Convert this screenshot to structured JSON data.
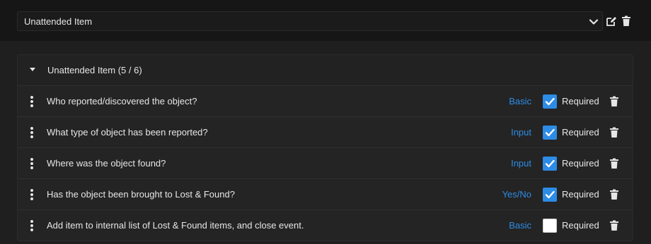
{
  "selector": {
    "value": "Unattended Item"
  },
  "panel": {
    "title": "Unattended Item (5 / 6)"
  },
  "items": [
    {
      "question": "Who reported/discovered the object?",
      "type": "Basic",
      "required": true,
      "required_label": "Required"
    },
    {
      "question": "What type of object has been reported?",
      "type": "Input",
      "required": true,
      "required_label": "Required"
    },
    {
      "question": "Where was the object found?",
      "type": "Input",
      "required": true,
      "required_label": "Required"
    },
    {
      "question": "Has the object been brought to Lost & Found?",
      "type": "Yes/No",
      "required": true,
      "required_label": "Required"
    },
    {
      "question": "Add item to internal list of Lost & Found items, and close event.",
      "type": "Basic",
      "required": false,
      "required_label": "Required"
    }
  ],
  "colors": {
    "accent": "#2d8ce6",
    "background": "#161616",
    "panel": "#242424",
    "text": "#e6e6e6"
  },
  "icons": [
    "chevron-down-icon",
    "edit-icon",
    "trash-icon",
    "caret-down-icon",
    "drag-handle-icon",
    "check-icon"
  ]
}
